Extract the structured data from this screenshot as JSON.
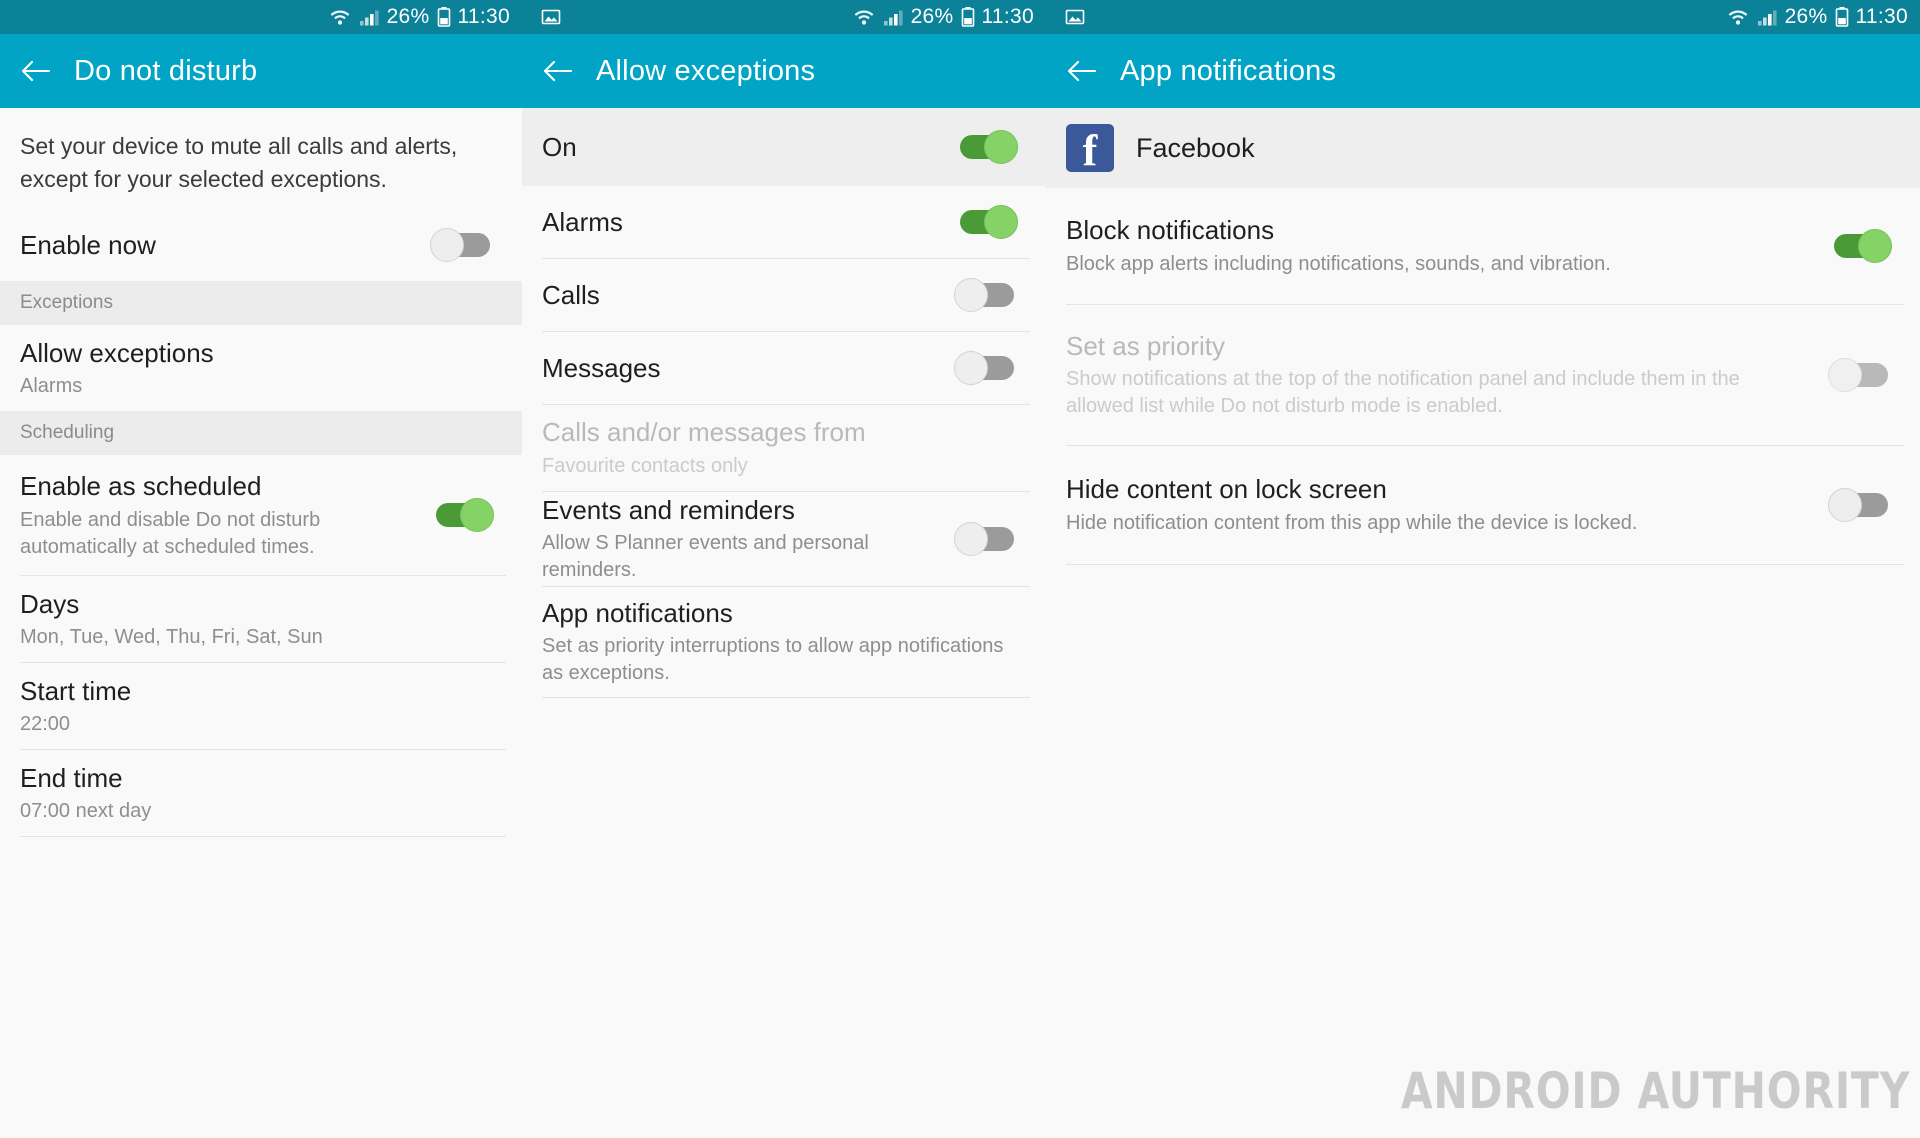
{
  "status_bar": {
    "battery_percent": "26%",
    "time": "11:30",
    "icons": [
      "wifi-icon",
      "signal-icon",
      "battery-icon",
      "screenshot-icon"
    ]
  },
  "panels": [
    {
      "title": "Do not disturb",
      "intro": "Set your device to mute all calls and alerts, except for your selected exceptions.",
      "items": [
        {
          "kind": "switch",
          "title": "Enable now",
          "sub": "",
          "toggle": "off"
        },
        {
          "kind": "header",
          "title": "Exceptions"
        },
        {
          "kind": "nav",
          "title": "Allow exceptions",
          "sub": "Alarms"
        },
        {
          "kind": "header",
          "title": "Scheduling"
        },
        {
          "kind": "switch",
          "title": "Enable as scheduled",
          "sub": "Enable and disable Do not disturb automatically at scheduled times.",
          "toggle": "on"
        },
        {
          "kind": "nav",
          "title": "Days",
          "sub": "Mon, Tue, Wed, Thu, Fri, Sat, Sun"
        },
        {
          "kind": "nav",
          "title": "Start time",
          "sub": "22:00"
        },
        {
          "kind": "nav",
          "title": "End time",
          "sub": "07:00 next day"
        }
      ]
    },
    {
      "title": "Allow exceptions",
      "items": [
        {
          "kind": "switch",
          "title": "On",
          "sub": "",
          "toggle": "on",
          "highlight": true
        },
        {
          "kind": "switch",
          "title": "Alarms",
          "sub": "",
          "toggle": "on"
        },
        {
          "kind": "switch",
          "title": "Calls",
          "sub": "",
          "toggle": "off"
        },
        {
          "kind": "switch",
          "title": "Messages",
          "sub": "",
          "toggle": "off"
        },
        {
          "kind": "nav",
          "title": "Calls and/or messages from",
          "sub": "Favourite contacts only",
          "disabled": true
        },
        {
          "kind": "switch",
          "title": "Events and reminders",
          "sub": "Allow S Planner events and personal reminders.",
          "toggle": "off"
        },
        {
          "kind": "nav",
          "title": "App notifications",
          "sub": "Set as priority interruptions to allow app notifications as exceptions."
        }
      ]
    },
    {
      "title": "App notifications",
      "app": {
        "name": "Facebook",
        "icon": "facebook-icon",
        "glyph": "f",
        "color": "#3b5998"
      },
      "items": [
        {
          "kind": "switch",
          "title": "Block notifications",
          "sub": "Block app alerts including notifications, sounds, and vibration.",
          "toggle": "on"
        },
        {
          "kind": "switch",
          "title": "Set as priority",
          "sub": "Show notifications at the top of the notification panel and include them in the allowed list while Do not disturb mode is enabled.",
          "toggle": "off",
          "disabled": true
        },
        {
          "kind": "switch",
          "title": "Hide content on lock screen",
          "sub": "Hide notification content from this app while the device is locked.",
          "toggle": "off"
        }
      ]
    }
  ],
  "watermark": "ANDROID AUTHORITY",
  "colors": {
    "status_bar": "#0b8298",
    "action_bar": "#01a4c4",
    "toggle_on": "#4a9a38",
    "toggle_knob_on": "#85d267",
    "toggle_off": "#9b9b9b",
    "facebook_blue": "#3b5998"
  }
}
